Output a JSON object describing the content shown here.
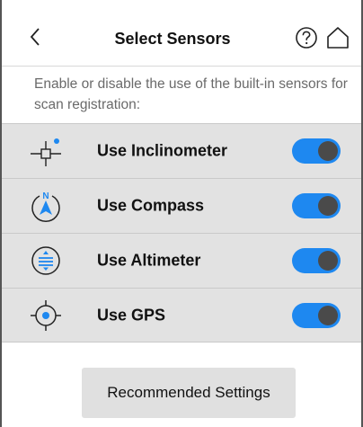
{
  "header": {
    "title": "Select Sensors"
  },
  "description": "Enable or disable the use of the built-in sensors for scan registration:",
  "sensors": [
    {
      "label": "Use Inclinometer",
      "icon": "inclinometer-icon",
      "enabled": true
    },
    {
      "label": "Use Compass",
      "icon": "compass-icon",
      "enabled": true
    },
    {
      "label": "Use Altimeter",
      "icon": "altimeter-icon",
      "enabled": true
    },
    {
      "label": "Use GPS",
      "icon": "gps-icon",
      "enabled": true
    }
  ],
  "footer": {
    "recommended_label": "Recommended Settings"
  },
  "colors": {
    "toggle_on": "#1e88f0",
    "accent_blue": "#1e88f0",
    "row_bg": "#e2e2e2"
  }
}
